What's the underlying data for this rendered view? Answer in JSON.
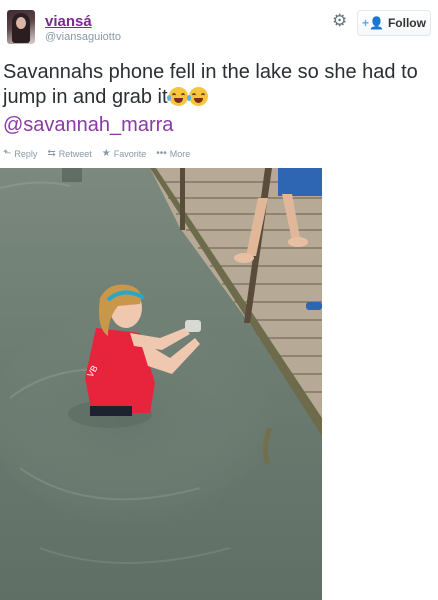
{
  "user": {
    "display_name": "viansá",
    "handle": "@viansaguiotto"
  },
  "header": {
    "settings_icon": "gear-icon",
    "follow_label": "Follow",
    "follow_icon": "add-user-icon"
  },
  "tweet": {
    "text": "Savannahs phone fell in the lake so she had to jump in and grab it",
    "emojis": [
      "face-with-tears-of-joy",
      "face-with-tears-of-joy"
    ],
    "mention": "@savannah_marra"
  },
  "actions": [
    {
      "icon": "reply-icon",
      "glyph": "⬑",
      "label": "Reply"
    },
    {
      "icon": "retweet-icon",
      "glyph": "⇆",
      "label": "Retweet"
    },
    {
      "icon": "favorite-star-icon",
      "glyph": "★",
      "label": "Favorite"
    },
    {
      "icon": "more-icon",
      "glyph": "•••",
      "label": "More"
    }
  ],
  "colors": {
    "username": "#7b2b8e",
    "link": "#8a3aa3",
    "muted": "#8899a6",
    "follow_icon": "#55acee",
    "lake_water": "#6f7f73",
    "dock_wood": "#b8ab97",
    "shirt": "#e8243c"
  }
}
